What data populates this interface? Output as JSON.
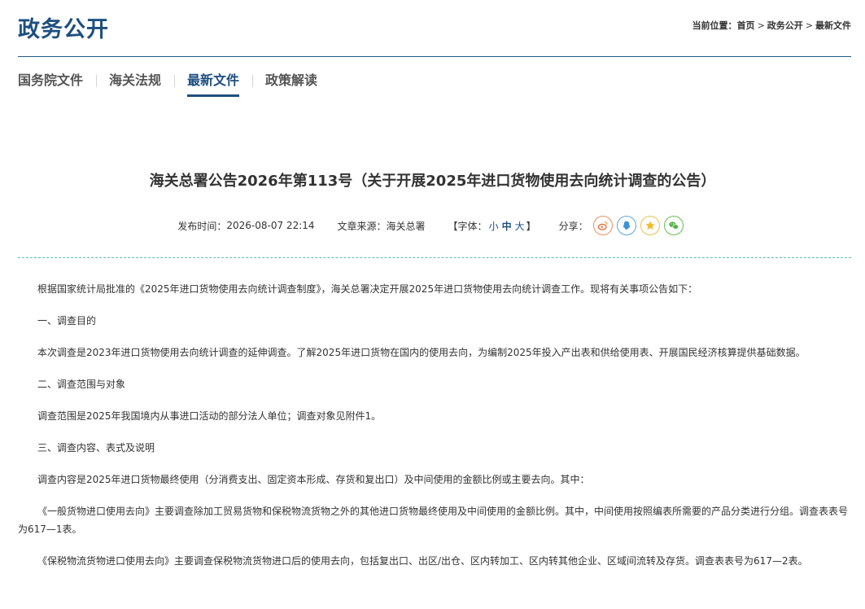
{
  "header": {
    "section_title": "政务公开",
    "breadcrumb": {
      "prefix": "当前位置：",
      "items": [
        "首页",
        "政务公开",
        "最新文件"
      ],
      "separator": ">"
    }
  },
  "nav": {
    "tabs": [
      {
        "label": "国务院文件",
        "active": false
      },
      {
        "label": "海关法规",
        "active": false
      },
      {
        "label": "最新文件",
        "active": true
      },
      {
        "label": "政策解读",
        "active": false
      }
    ],
    "accent_color": "#1d4f80"
  },
  "article": {
    "title": "海关总署公告2026年第113号（关于开展2025年进口货物使用去向统计调查的公告）",
    "meta": {
      "publish_label": "发布时间：",
      "publish_time": "2026-08-07 22:14",
      "source_label": "文章来源：",
      "source": "海关总署",
      "font_label_open": "【字体：",
      "font_small": "小",
      "font_medium": "中",
      "font_large": "大",
      "font_label_close": "】",
      "share_label": "分享：",
      "share_icons": [
        "weibo-icon",
        "qq-icon",
        "qzone-icon",
        "wechat-icon"
      ]
    },
    "paragraphs": [
      "根据国家统计局批准的《2025年进口货物使用去向统计调查制度》，海关总署决定开展2025年进口货物使用去向统计调查工作。现将有关事项公告如下：",
      "一、调查目的",
      "本次调查是2023年进口货物使用去向统计调查的延伸调查。了解2025年进口货物在国内的使用去向，为编制2025年投入产出表和供给使用表、开展国民经济核算提供基础数据。",
      "二、调查范围与对象",
      "调查范围是2025年我国境内从事进口活动的部分法人单位；调查对象见附件1。",
      "三、调查内容、表式及说明",
      "调查内容是2025年进口货物最终使用（分消费支出、固定资本形成、存货和复出口）及中间使用的金额比例或主要去向。其中：",
      "《一般货物进口使用去向》主要调查除加工贸易货物和保税物流货物之外的其他进口货物最终使用及中间使用的金额比例。其中，中间使用按照编表所需要的产品分类进行分组。调查表表号为617—1表。",
      "《保税物流货物进口使用去向》主要调查保税物流货物进口后的使用去向，包括复出口、出区/出仓、区内转加工、区内转其他企业、区域间流转及存货。调查表表号为617—2表。"
    ]
  }
}
